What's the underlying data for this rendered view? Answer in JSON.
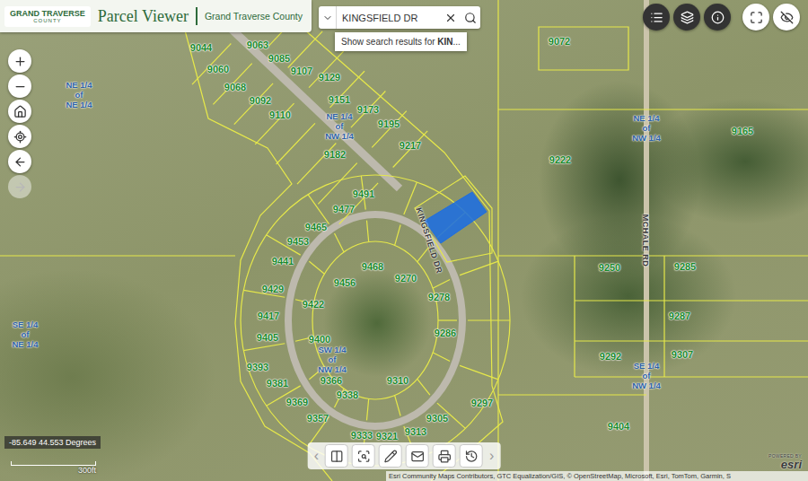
{
  "header": {
    "logo": {
      "line1": "GRAND TRAVERSE",
      "line2": "COUNTY"
    },
    "title": "Parcel Viewer",
    "subtitle": "Grand Traverse County"
  },
  "search": {
    "value": "KINGSFIELD DR",
    "suggestion": {
      "prefix": "Show search results for ",
      "match": "KIN",
      "suffix": "..."
    }
  },
  "nav_buttons": [
    {
      "kind": "zoom-in",
      "disabled": false
    },
    {
      "kind": "zoom-out",
      "disabled": false
    },
    {
      "kind": "home",
      "disabled": false
    },
    {
      "kind": "locate",
      "disabled": false
    },
    {
      "kind": "back",
      "disabled": false
    },
    {
      "kind": "forward",
      "disabled": true
    }
  ],
  "widget_buttons": [
    {
      "kind": "list"
    },
    {
      "kind": "layers"
    },
    {
      "kind": "info"
    }
  ],
  "view_buttons": [
    {
      "kind": "fullscreen"
    },
    {
      "kind": "hide"
    }
  ],
  "map": {
    "parcels": [
      "9044",
      "9063",
      "9085",
      "9107",
      "9129",
      "9060",
      "9068",
      "9092",
      "9110",
      "9151",
      "9173",
      "9195",
      "9217",
      "9182",
      "9491",
      "9477",
      "9465",
      "9453",
      "9441",
      "9468",
      "9270",
      "9456",
      "9278",
      "9429",
      "9422",
      "9417",
      "9286",
      "9400",
      "9405",
      "9393",
      "9366",
      "9338",
      "9310",
      "9381",
      "9369",
      "9297",
      "9305",
      "9357",
      "9313",
      "9333",
      "9321",
      "9072",
      "9165",
      "9222",
      "9250",
      "9285",
      "9287",
      "9292",
      "9307",
      "9404"
    ],
    "sections": [
      {
        "lines": [
          "NE 1/4",
          "of",
          "NE 1/4"
        ]
      },
      {
        "lines": [
          "NE 1/4",
          "of",
          "NW 1/4"
        ]
      },
      {
        "lines": [
          "NE 1/4",
          "of",
          "NW 1/4"
        ]
      },
      {
        "lines": [
          "SE 1/4",
          "of",
          "NE 1/4"
        ]
      },
      {
        "lines": [
          "SW 1/4",
          "of",
          "NW 1/4"
        ]
      },
      {
        "lines": [
          "SE 1/4",
          "of",
          "NW 1/4"
        ]
      }
    ],
    "roads": [
      "KINGSFIELD DR",
      "MCHALE RD"
    ],
    "selected_parcel": {
      "selected": true
    }
  },
  "coordinates": "-85.649 44.553 Degrees",
  "scale": "300ft",
  "attribution": "Esri Community Maps Contributors, GTC Equalization/GIS, © OpenStreetMap, Microsoft, Esri, TomTom, Garmin, S",
  "toolbar": {
    "prev": "‹",
    "next": "›",
    "tools": [
      {
        "kind": "split"
      },
      {
        "kind": "search-area"
      },
      {
        "kind": "draw"
      },
      {
        "kind": "share"
      },
      {
        "kind": "print"
      },
      {
        "kind": "history"
      }
    ]
  },
  "esri": {
    "powered_by": "POWERED BY",
    "brand": "esri"
  }
}
